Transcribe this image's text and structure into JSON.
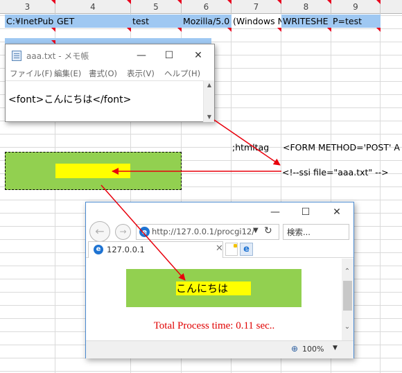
{
  "spreadsheet": {
    "column_headers": [
      "3",
      "4",
      "5",
      "6",
      "7",
      "8",
      "9"
    ],
    "row_cells": [
      "C:¥InetPub",
      "GET",
      "test",
      "Mozilla/5.0",
      "(Windows N",
      "WRITESHE",
      "P=test"
    ],
    "htmltag_label": ";htmltag",
    "form_text": "<FORM METHOD='POST' A",
    "ssi_text": "<!--ssi file=\"aaa.txt\" -->"
  },
  "notepad": {
    "title": "aaa.txt - メモ帳",
    "menu": [
      "ファイル(F)",
      "編集(E)",
      "書式(O)",
      "表示(V)",
      "ヘルプ(H)"
    ],
    "content": "<font>こんにちは</font>",
    "minimize": "—",
    "maximize": "☐",
    "close": "✕"
  },
  "browser": {
    "url": "http://127.0.0.1/procgi12/",
    "search_placeholder": "検索...",
    "tab_title": "127.0.0.1",
    "greeting": "こんにちは",
    "process_time": "Total Process time: 0.11 sec..",
    "zoom": "100%",
    "minimize": "—",
    "maximize": "☐",
    "close": "✕"
  },
  "colors": {
    "green": "#92d050",
    "yellow": "#ffff00",
    "arrow_red": "#e8000c",
    "cell_blue": "#9fc8f2"
  },
  "icons": [
    "notepad-icon",
    "back-icon",
    "forward-icon",
    "ie-icon",
    "refresh-icon",
    "zoom-icon",
    "close-icon",
    "minimize-icon",
    "maximize-icon",
    "new-tab-icon",
    "dropdown-arrow-icon"
  ]
}
